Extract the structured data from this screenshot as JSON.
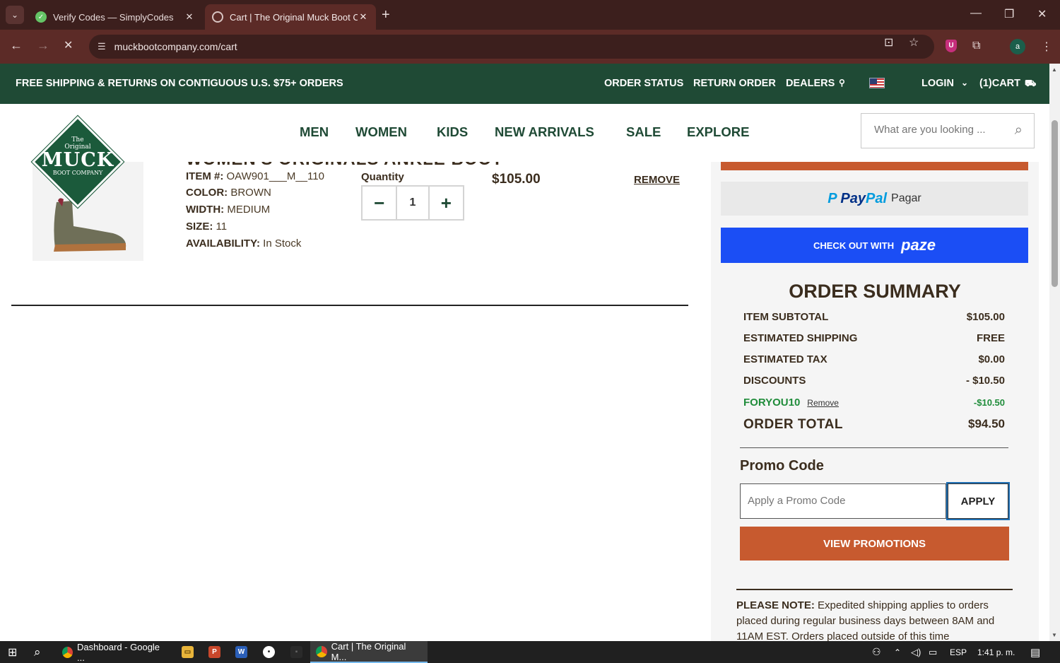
{
  "browser": {
    "tabs": [
      {
        "title": "Verify Codes — SimplyCodes",
        "close": "✕"
      },
      {
        "title": "Cart | The Original Muck Boot Co",
        "close": "✕"
      }
    ],
    "new_tab": "+",
    "url": "muckbootcompany.com/cart",
    "window_controls": [
      "—",
      "❐",
      "✕"
    ],
    "profile_initial": "a",
    "extension_badge": "U"
  },
  "site": {
    "promo_banner": "FREE SHIPPING & RETURNS ON CONTIGUOUS U.S. $75+ ORDERS",
    "top_links": {
      "order_status": "ORDER STATUS",
      "return_order": "RETURN ORDER",
      "dealers": "DEALERS",
      "login": "LOGIN",
      "cart": "(1)CART"
    },
    "logo": {
      "line1": "The",
      "line2": "Original",
      "line3": "MUCK",
      "line4": "BOOT COMPANY"
    },
    "nav": [
      "MEN",
      "WOMEN",
      "KIDS",
      "NEW ARRIVALS",
      "SALE",
      "EXPLORE"
    ],
    "search_placeholder": "What are you looking ..."
  },
  "cart_item": {
    "title_partial": "WOMEN'S ORIGINALS ANKLE BOOT",
    "item_label": "ITEM #:",
    "item_value": "OAW901___M__110",
    "color_label": "COLOR:",
    "color_value": "BROWN",
    "width_label": "WIDTH:",
    "width_value": "MEDIUM",
    "size_label": "SIZE:",
    "size_value": "11",
    "availability_label": "AVAILABILITY:",
    "availability_value": "In Stock",
    "quantity_label": "Quantity",
    "quantity": "1",
    "minus": "−",
    "plus": "+",
    "price": "$105.00",
    "remove": "REMOVE"
  },
  "summary": {
    "paypal_brand_p": "Pay",
    "paypal_brand_pal": "Pal",
    "paypal_action": "Pagar",
    "paze_prefix": "CHECK OUT WITH",
    "paze_brand": "paze",
    "title": "ORDER SUMMARY",
    "rows": [
      {
        "label": "ITEM SUBTOTAL",
        "value": "$105.00"
      },
      {
        "label": "ESTIMATED SHIPPING",
        "value": "FREE"
      },
      {
        "label": "ESTIMATED TAX",
        "value": "$0.00"
      },
      {
        "label": "DISCOUNTS",
        "value": "- $10.50"
      }
    ],
    "applied_code": "FORYOU10",
    "applied_code_remove": "Remove",
    "applied_code_amount": "-$10.50",
    "total_label": "ORDER TOTAL",
    "total_value": "$94.50",
    "promo_title": "Promo Code",
    "promo_placeholder": "Apply a Promo Code",
    "apply": "APPLY",
    "view_promotions": "VIEW PROMOTIONS",
    "note_bold": "PLEASE NOTE:",
    "note_text": " Expedited shipping applies to orders placed during regular business days between 8AM and 11AM EST. Orders placed outside of this time"
  },
  "taskbar": {
    "apps": [
      {
        "label": "Dashboard - Google ..."
      },
      {
        "label": "Cart | The Original M..."
      }
    ],
    "language": "ESP",
    "time": "1:41 p. m."
  },
  "colors": {
    "brand_green": "#1f4a35",
    "accent_orange": "#c75a2f",
    "paze_blue": "#1b4ef5",
    "browser_frame": "#3c1f1d"
  }
}
